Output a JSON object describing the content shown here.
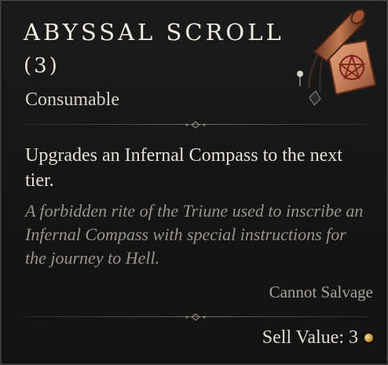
{
  "item": {
    "name": "Abyssal Scroll",
    "count": "(3)",
    "type": "Consumable",
    "description": "Upgrades an Infernal Compass to the next tier.",
    "flavor": "A forbidden rite of the Triune used to inscribe an Infernal Compass with special instructions for the journey to Hell.",
    "salvage": "Cannot Salvage",
    "sell_value": "Sell Value: 3",
    "icon": "abyssal-scroll-icon",
    "currency_icon": "gold-coin-icon"
  },
  "colors": {
    "background": "#151515",
    "title": "#f1ece2",
    "flavor_text": "#9b968d",
    "scroll_parchment": "#c9835e",
    "scroll_seal": "#7d1f17",
    "gold": "#c99a3a"
  }
}
